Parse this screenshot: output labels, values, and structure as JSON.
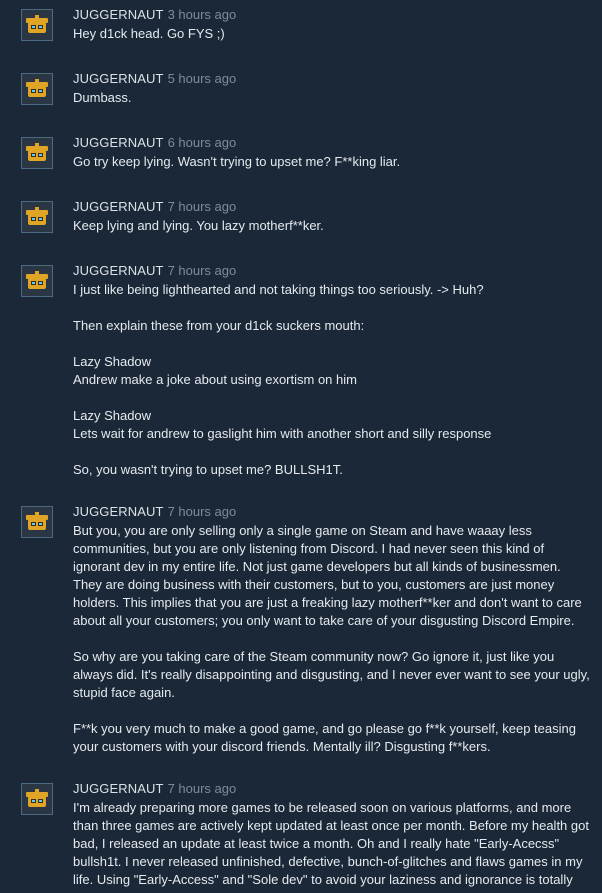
{
  "comments": [
    {
      "author": "JUGGERNAUT",
      "timestamp": "3 hours ago",
      "paragraphs": [
        "Hey d1ck head. Go FYS ;)"
      ]
    },
    {
      "author": "JUGGERNAUT",
      "timestamp": "5 hours ago",
      "paragraphs": [
        "Dumbass."
      ]
    },
    {
      "author": "JUGGERNAUT",
      "timestamp": "6 hours ago",
      "paragraphs": [
        "Go try keep lying. Wasn't trying to upset me? F**king liar."
      ]
    },
    {
      "author": "JUGGERNAUT",
      "timestamp": "7 hours ago",
      "paragraphs": [
        "Keep lying and lying. You lazy motherf**ker."
      ]
    },
    {
      "author": "JUGGERNAUT",
      "timestamp": "7 hours ago",
      "paragraphs": [
        "I just like being lighthearted and not taking things too seriously. -> Huh?",
        "Then explain these from your d1ck suckers mouth:",
        "Lazy Shadow\nAndrew make a joke about using exortism on him",
        "Lazy Shadow\nLets wait for andrew to gaslight him with another short and silly response",
        "So, you wasn't trying to upset me? BULLSH1T."
      ]
    },
    {
      "author": "JUGGERNAUT",
      "timestamp": "7 hours ago",
      "paragraphs": [
        "But you, you are only selling only a single game on Steam and have waaay less communities, but you are only listening from Discord. I had never seen this kind of ignorant dev in my entire life. Not just game developers but all kinds of businessmen. They are doing business with their customers, but to you, customers are just money holders. This implies that you are just a freaking lazy motherf**ker and don't want to care about all your customers; you only want to take care of your disgusting Discord Empire.",
        "So why are you taking care of the Steam community now? Go ignore it, just like you always did. It's really disappointing and disgusting, and I never ever want to see your ugly, stupid face again.",
        "F**k you very much to make a good game, and go please go f**k yourself, keep teasing your customers with your discord friends. Mentally ill? Disgusting f**kers."
      ]
    },
    {
      "author": "JUGGERNAUT",
      "timestamp": "7 hours ago",
      "paragraphs": [
        "I'm already preparing more games to be released soon on various platforms, and more than three games are actively kept updated at least once per month. Before my health got bad, I released an update at least twice a month. Oh and I really hate \"Early-Acecss\" bullsh1t. I never released unfinished, defective, bunch-of-glitches and flaws games in my life. Using \"Early-Access\" and \"Sole dev\" to avoid your laziness and ignorance is totally"
      ]
    }
  ],
  "colors": {
    "background": "#1b2838",
    "author": "#dbe2e6",
    "timestamp": "#7d8c99",
    "text": "#e5eaee",
    "avatar_face": "#e0a526"
  },
  "icons": {
    "avatar": "yellow-robot-face-avatar-icon"
  }
}
